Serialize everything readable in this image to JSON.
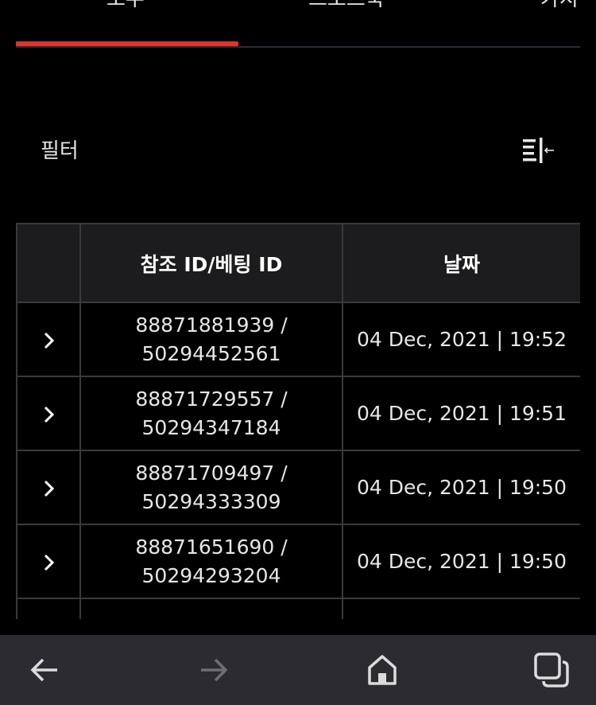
{
  "tabs": [
    {
      "label": "모두",
      "active": true
    },
    {
      "label": "스포츠북",
      "active": false
    },
    {
      "label": "카지",
      "active": false
    }
  ],
  "filter": {
    "label": "필터",
    "icon": "filter-collapse-icon"
  },
  "table": {
    "headers": [
      "",
      "참조 ID/베팅 ID",
      "날짜"
    ],
    "rows": [
      {
        "ref_id": "88871881939 /",
        "bet_id": "50294452561",
        "date": "04 Dec, 2021 | 19:52"
      },
      {
        "ref_id": "88871729557 /",
        "bet_id": "50294347184",
        "date": "04 Dec, 2021 | 19:51"
      },
      {
        "ref_id": "88871709497 /",
        "bet_id": "50294333309",
        "date": "04 Dec, 2021 | 19:50"
      },
      {
        "ref_id": "88871651690 /",
        "bet_id": "50294293204",
        "date": "04 Dec, 2021 | 19:50"
      }
    ]
  },
  "navbar": {
    "icons": [
      "back-arrow-icon",
      "forward-arrow-icon",
      "home-icon",
      "tabs-icon"
    ]
  },
  "colors": {
    "accent": "#e0322f",
    "background": "#000000",
    "header_bg": "#1c1c1e",
    "navbar_bg": "#2b2b30"
  }
}
